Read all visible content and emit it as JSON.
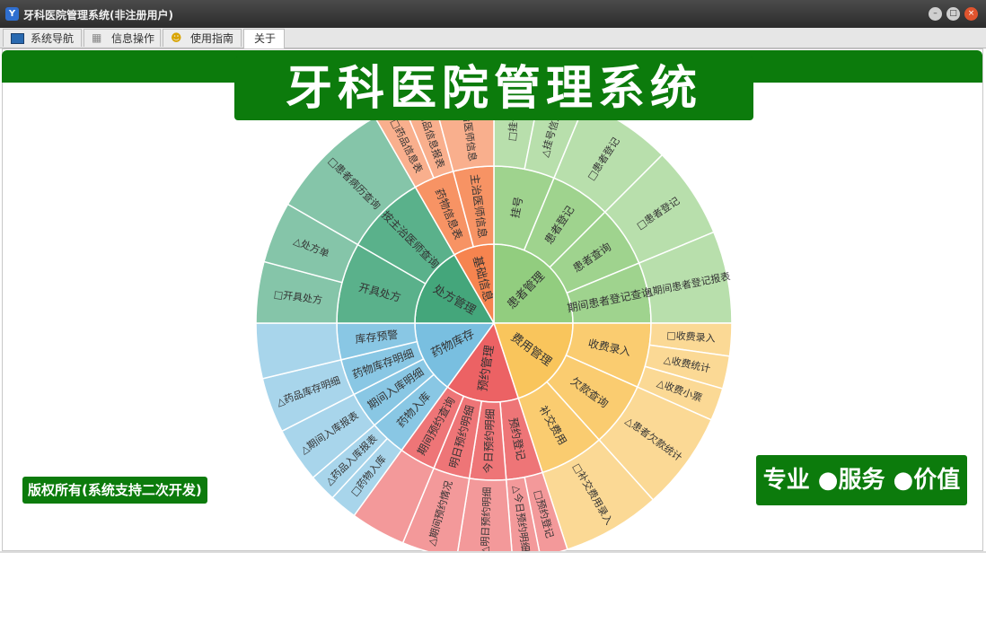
{
  "window": {
    "title": "牙科医院管理系统(非注册用户)"
  },
  "tabs": [
    {
      "label": "系统导航",
      "icon": "monitor-icon"
    },
    {
      "label": "信息操作",
      "icon": "grid-icon"
    },
    {
      "label": "使用指南",
      "icon": "smile-icon"
    },
    {
      "label": "关于",
      "icon": ""
    }
  ],
  "banner": {
    "title": "牙科医院管理系统"
  },
  "footer": {
    "copyright": "版权所有(系统支持二次开发)",
    "slogan": "专业 ●服务 ●价值"
  },
  "colors": {
    "brand_green": "#0c7b0c"
  },
  "sunburst": [
    {
      "label": "患者管理",
      "color": "#92cd7f",
      "children": [
        {
          "label": "挂号",
          "children": [
            {
              "label": "□挂号"
            },
            {
              "label": "△挂号信息"
            }
          ]
        },
        {
          "label": "患者登记",
          "children": [
            {
              "label": "□患者登记"
            }
          ]
        },
        {
          "label": "患者查询",
          "children": [
            {
              "label": "□患者登记"
            }
          ]
        },
        {
          "label": "期间患者登记查询",
          "children": [
            {
              "label": "△期间患者登记报表"
            }
          ]
        }
      ]
    },
    {
      "label": "费用管理",
      "color": "#f9c55c",
      "children": [
        {
          "label": "收费录入",
          "children": [
            {
              "label": "□收费录入"
            },
            {
              "label": "△收费统计"
            },
            {
              "label": "△收费小票"
            }
          ]
        },
        {
          "label": "欠款查询",
          "children": [
            {
              "label": "△患者欠款统计"
            }
          ]
        },
        {
          "label": "补交费用",
          "children": [
            {
              "label": "□补交费用录入"
            }
          ]
        }
      ]
    },
    {
      "label": "预约管理",
      "color": "#ec6264",
      "children": [
        {
          "label": "预约登记",
          "children": [
            {
              "label": "□预约登记"
            },
            {
              "label": "△今日预约明细"
            }
          ]
        },
        {
          "label": "今日预约明细",
          "children": [
            {
              "label": "△明日预约明细"
            }
          ]
        },
        {
          "label": "明日预约明细",
          "children": [
            {
              "label": "△期间预约情况"
            }
          ]
        },
        {
          "label": "期间预约查询",
          "children": [
            {
              "label": ""
            }
          ]
        }
      ]
    },
    {
      "label": "药物库存",
      "color": "#79bfe0",
      "children": [
        {
          "label": "药物入库",
          "children": [
            {
              "label": "□药物入库"
            },
            {
              "label": "△药品入库报表"
            }
          ]
        },
        {
          "label": "期间入库明细",
          "children": [
            {
              "label": "△期间入库报表"
            }
          ]
        },
        {
          "label": "药物库存明细",
          "children": [
            {
              "label": "△药品库存明细"
            }
          ]
        },
        {
          "label": "库存预警",
          "children": [
            {
              "label": ""
            }
          ]
        }
      ]
    },
    {
      "label": "处方管理",
      "color": "#44a67b",
      "children": [
        {
          "label": "开具处方",
          "children": [
            {
              "label": "□开具处方"
            },
            {
              "label": "△处方单"
            }
          ]
        },
        {
          "label": "按主治医师查询",
          "children": [
            {
              "label": "□患者病历查询"
            }
          ]
        }
      ]
    },
    {
      "label": "基础信息",
      "color": "#f6844f",
      "children": [
        {
          "label": "药物信息表",
          "children": [
            {
              "label": "□药品信息表"
            },
            {
              "label": "△药品信息报表"
            }
          ]
        },
        {
          "label": "主治医师信息",
          "children": [
            {
              "label": "□主治医师信息"
            }
          ]
        }
      ]
    }
  ]
}
